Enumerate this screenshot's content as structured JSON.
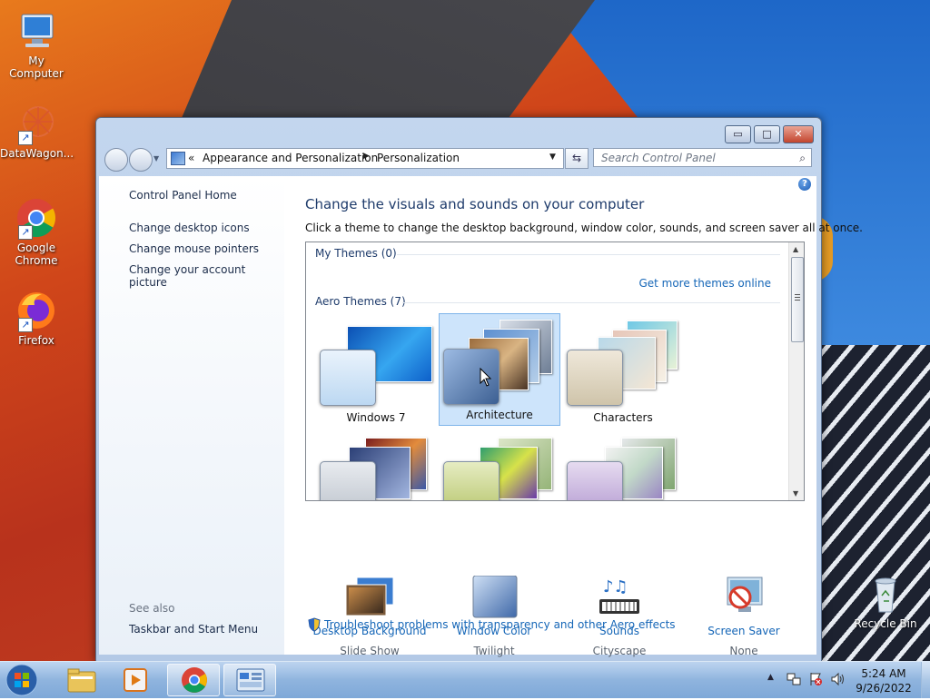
{
  "desktop": {
    "icons": [
      {
        "label": "My Computer"
      },
      {
        "label": "DataWagon..."
      },
      {
        "label": "Google Chrome"
      },
      {
        "label": "Firefox"
      },
      {
        "label": "Recycle Bin"
      }
    ]
  },
  "window": {
    "title_buttons": {
      "minimize": "▭",
      "maximize": "□",
      "close": "✕"
    },
    "address": {
      "overflow": "«",
      "crumbs": [
        "Appearance and Personalization",
        "Personalization"
      ]
    },
    "search": {
      "placeholder": "Search Control Panel"
    },
    "help": "?",
    "left_pane": {
      "home": "Control Panel Home",
      "links": [
        "Change desktop icons",
        "Change mouse pointers",
        "Change your account picture"
      ],
      "see_also_heading": "See also",
      "see_also": [
        "Taskbar and Start Menu"
      ]
    },
    "main": {
      "heading": "Change the visuals and sounds on your computer",
      "instruction": "Click a theme to change the desktop background, window color, sounds, and screen saver all at once.",
      "my_themes": "My Themes (0)",
      "get_more": "Get more themes online",
      "aero_themes": "Aero Themes (7)",
      "themes": [
        {
          "name": "Windows 7",
          "selected": false
        },
        {
          "name": "Architecture",
          "selected": true
        },
        {
          "name": "Characters",
          "selected": false
        }
      ],
      "settings": [
        {
          "link": "Desktop Background",
          "value": "Slide Show"
        },
        {
          "link": "Window Color",
          "value": "Twilight"
        },
        {
          "link": "Sounds",
          "value": "Cityscape"
        },
        {
          "link": "Screen Saver",
          "value": "None"
        }
      ],
      "troubleshoot": "Troubleshoot problems with transparency and other Aero effects"
    }
  },
  "taskbar": {
    "time": "5:24 AM",
    "date": "9/26/2022"
  },
  "colors": {
    "link": "#1566b7",
    "heading": "#1e3b6b",
    "selection": "#cde4fb"
  }
}
